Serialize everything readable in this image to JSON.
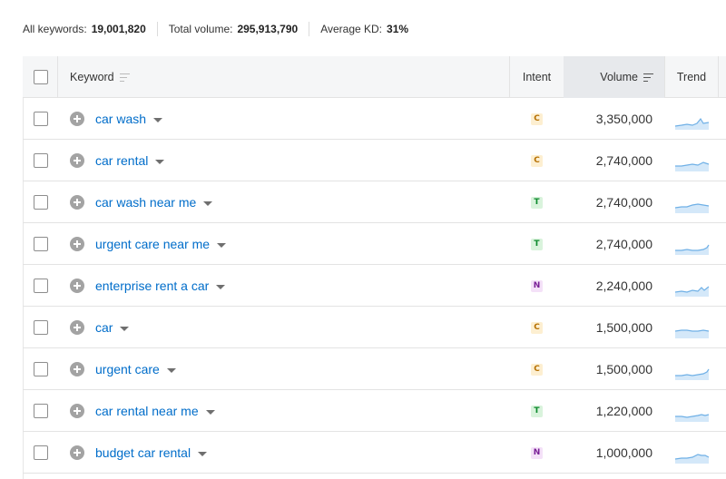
{
  "summary": {
    "all_keywords_label": "All keywords:",
    "all_keywords_value": "19,001,820",
    "total_volume_label": "Total volume:",
    "total_volume_value": "295,913,790",
    "avg_kd_label": "Average KD:",
    "avg_kd_value": "31%"
  },
  "columns": {
    "keyword": "Keyword",
    "intent": "Intent",
    "volume": "Volume",
    "trend": "Trend"
  },
  "intent_colors": {
    "C": {
      "bg": "#fdefd1",
      "fg": "#b56f00"
    },
    "T": {
      "bg": "#d9f3dc",
      "fg": "#0d8a2d"
    },
    "N": {
      "bg": "#f4e1f8",
      "fg": "#7a1f97"
    }
  },
  "trend_color": "#6fb0e6",
  "rows": [
    {
      "keyword": "car wash",
      "intent": "C",
      "volume": "3,350,000",
      "trend_icon": "sparkline"
    },
    {
      "keyword": "car rental",
      "intent": "C",
      "volume": "2,740,000",
      "trend_icon": "sparkline"
    },
    {
      "keyword": "car wash near me",
      "intent": "T",
      "volume": "2,740,000",
      "trend_icon": "sparkline"
    },
    {
      "keyword": "urgent care near me",
      "intent": "T",
      "volume": "2,740,000",
      "trend_icon": "sparkline"
    },
    {
      "keyword": "enterprise rent a car",
      "intent": "N",
      "volume": "2,240,000",
      "trend_icon": "sparkline"
    },
    {
      "keyword": "car",
      "intent": "C",
      "volume": "1,500,000",
      "trend_icon": "sparkline"
    },
    {
      "keyword": "urgent care",
      "intent": "C",
      "volume": "1,500,000",
      "trend_icon": "sparkline"
    },
    {
      "keyword": "car rental near me",
      "intent": "T",
      "volume": "1,220,000",
      "trend_icon": "sparkline"
    },
    {
      "keyword": "budget car rental",
      "intent": "N",
      "volume": "1,000,000",
      "trend_icon": "sparkline"
    }
  ]
}
